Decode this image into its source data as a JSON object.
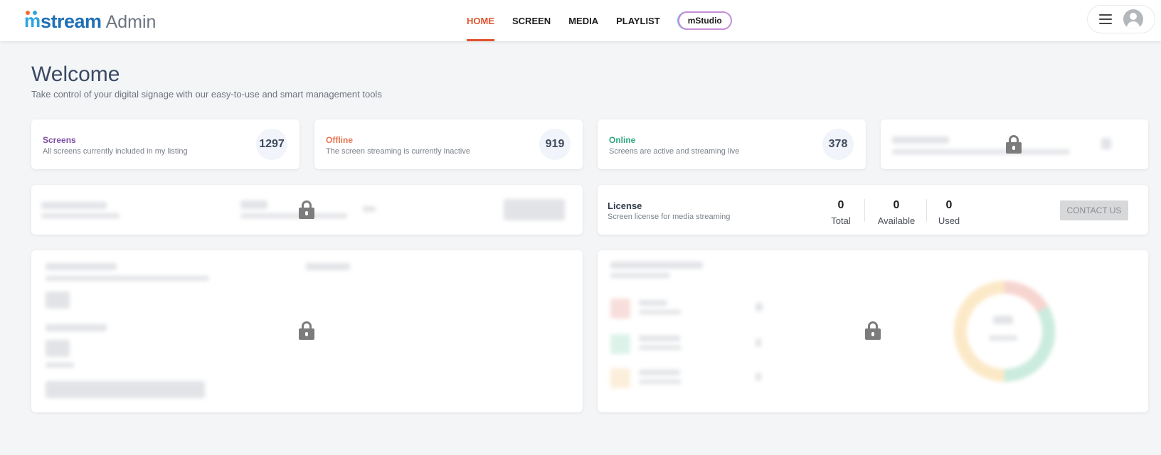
{
  "header": {
    "logo_word": "stream",
    "logo_mark_letter": "m",
    "logo_suffix": "Admin",
    "nav": [
      {
        "label": "HOME",
        "active": true
      },
      {
        "label": "SCREEN",
        "active": false
      },
      {
        "label": "MEDIA",
        "active": false
      },
      {
        "label": "PLAYLIST",
        "active": false
      }
    ],
    "studio_label": "mStudio"
  },
  "welcome": {
    "title": "Welcome",
    "subtitle": "Take control of your digital signage with our easy-to-use and smart management tools"
  },
  "stats": [
    {
      "title": "Screens",
      "desc": "All screens currently included in my listing",
      "value": "1297",
      "color": "#7b4fa0"
    },
    {
      "title": "Offline",
      "desc": "The screen streaming is currently inactive",
      "value": "919",
      "color": "#e8754f"
    },
    {
      "title": "Online",
      "desc": "Screens are active and streaming live",
      "value": "378",
      "color": "#2aa57c"
    }
  ],
  "license": {
    "title": "License",
    "desc": "Screen license for media streaming",
    "columns": [
      {
        "value": "0",
        "label": "Total"
      },
      {
        "value": "0",
        "label": "Available"
      },
      {
        "value": "0",
        "label": "Used"
      }
    ],
    "contact_label": "CONTACT US"
  },
  "locked_sections": [
    "stat-card-4",
    "media-streaming-card",
    "total-screens-card",
    "screen-status-card"
  ],
  "icons": [
    "lock-icon",
    "hamburger-icon",
    "avatar-icon"
  ]
}
